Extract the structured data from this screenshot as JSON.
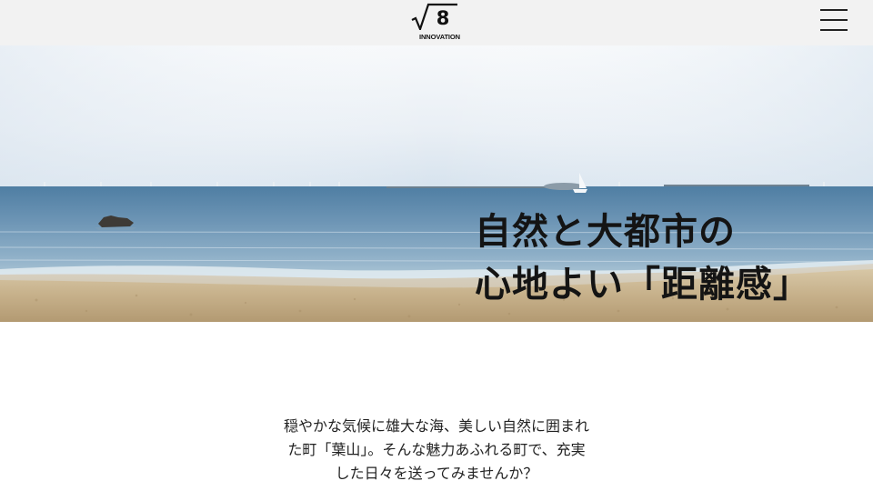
{
  "header": {
    "logo": {
      "mark": "8",
      "subtitle": "INNOVATION"
    },
    "menu_icon": "hamburger-menu-icon"
  },
  "hero": {
    "image": "beach-sea-horizon-photo",
    "title_lines": [
      "自然と大都市の",
      "心地よい「距離感」"
    ]
  },
  "intro": {
    "lines": [
      "穏やかな気候に雄大な海、美しい自然に囲まれ",
      "た町「葉山」。そんな魅力あふれる町で、充実",
      "した日々を送ってみませんか？"
    ]
  },
  "colors": {
    "header_bg": "#f2f2f2",
    "text": "#141414",
    "sea": "#5f88a8",
    "sand": "#c8b48f"
  }
}
